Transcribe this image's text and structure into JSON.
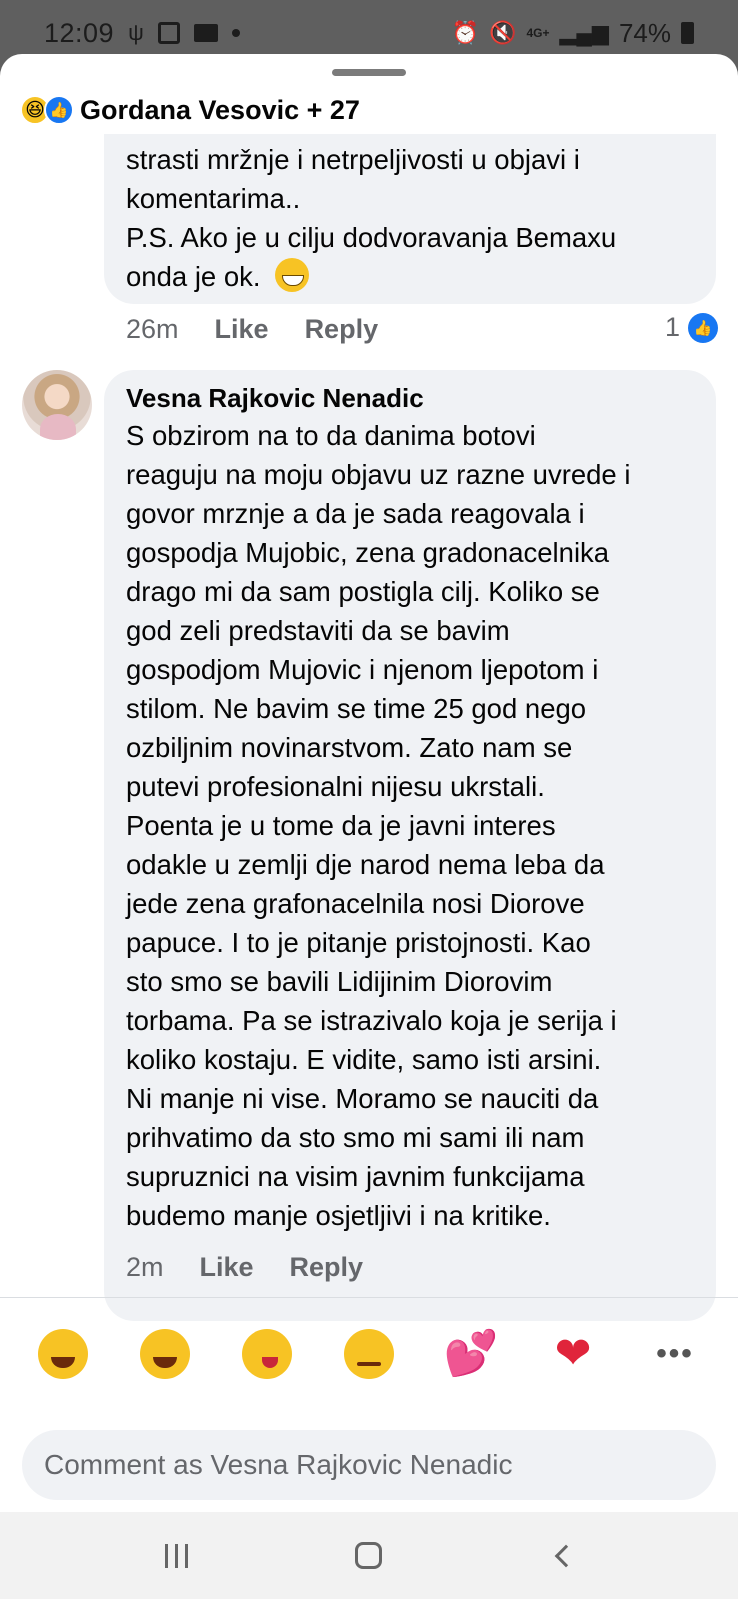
{
  "status_bar": {
    "time": "12:09",
    "network": "4G+",
    "battery": "74%"
  },
  "reactions_header": {
    "names": "Gordana Vesovic + 27",
    "icons": [
      "haha-reaction-icon",
      "like-reaction-icon"
    ]
  },
  "comments": [
    {
      "lines": [
        "strasti mržnje i netrpeljivosti u objavi i",
        "komentarima..",
        "P.S. Ako je u cilju dodvoravanja Bemaxu",
        "onda je ok."
      ],
      "time": "26m",
      "like_label": "Like",
      "reply_label": "Reply",
      "like_count": "1"
    },
    {
      "author": "Vesna Rajkovic Nenadic",
      "lines": [
        "S obzirom na to da danima botovi",
        "reaguju na moju objavu uz razne uvrede i",
        "govor mrznje a da je sada reagovala i",
        "gospodja Mujobic, zena gradonacelnika",
        "drago mi da sam postigla cilj. Koliko se",
        "god zeli predstaviti da se bavim",
        "gospodjom Mujovic i njenom ljepotom i",
        "stilom. Ne bavim se time 25 god nego",
        "ozbiljnim novinarstvom. Zato nam se",
        "putevi profesionalni nijesu ukrstali.",
        "Poenta je u tome da je javni interes",
        "odakle u zemlji dje narod nema leba da",
        "jede zena grafonacelnila nosi Diorove",
        "papuce. I to je pitanje pristojnosti. Kao",
        "sto smo se bavili Lidijinim Diorovim",
        "torbama. Pa se istrazivalo koja je serija i",
        "koliko kostaju. E vidite, samo isti arsini.",
        "Ni manje ni vise. Moramo se nauciti da",
        "prihvatimo da sto smo mi sami ili nam",
        "supruznici na visim javnim funkcijama",
        "budemo manje osjetljivi i na kritike."
      ],
      "time": "2m",
      "like_label": "Like",
      "reply_label": "Reply"
    }
  ],
  "quick_emojis": [
    "rolling-laughing",
    "grinning",
    "winking-tongue",
    "thinking",
    "two-hearts",
    "beating-heart",
    "more"
  ],
  "composer": {
    "placeholder": "Comment as Vesna Rajkovic Nenadic"
  },
  "colors": {
    "like_blue": "#1877f2",
    "bubble_bg": "#f0f2f5",
    "meta_gray": "#65676b"
  }
}
